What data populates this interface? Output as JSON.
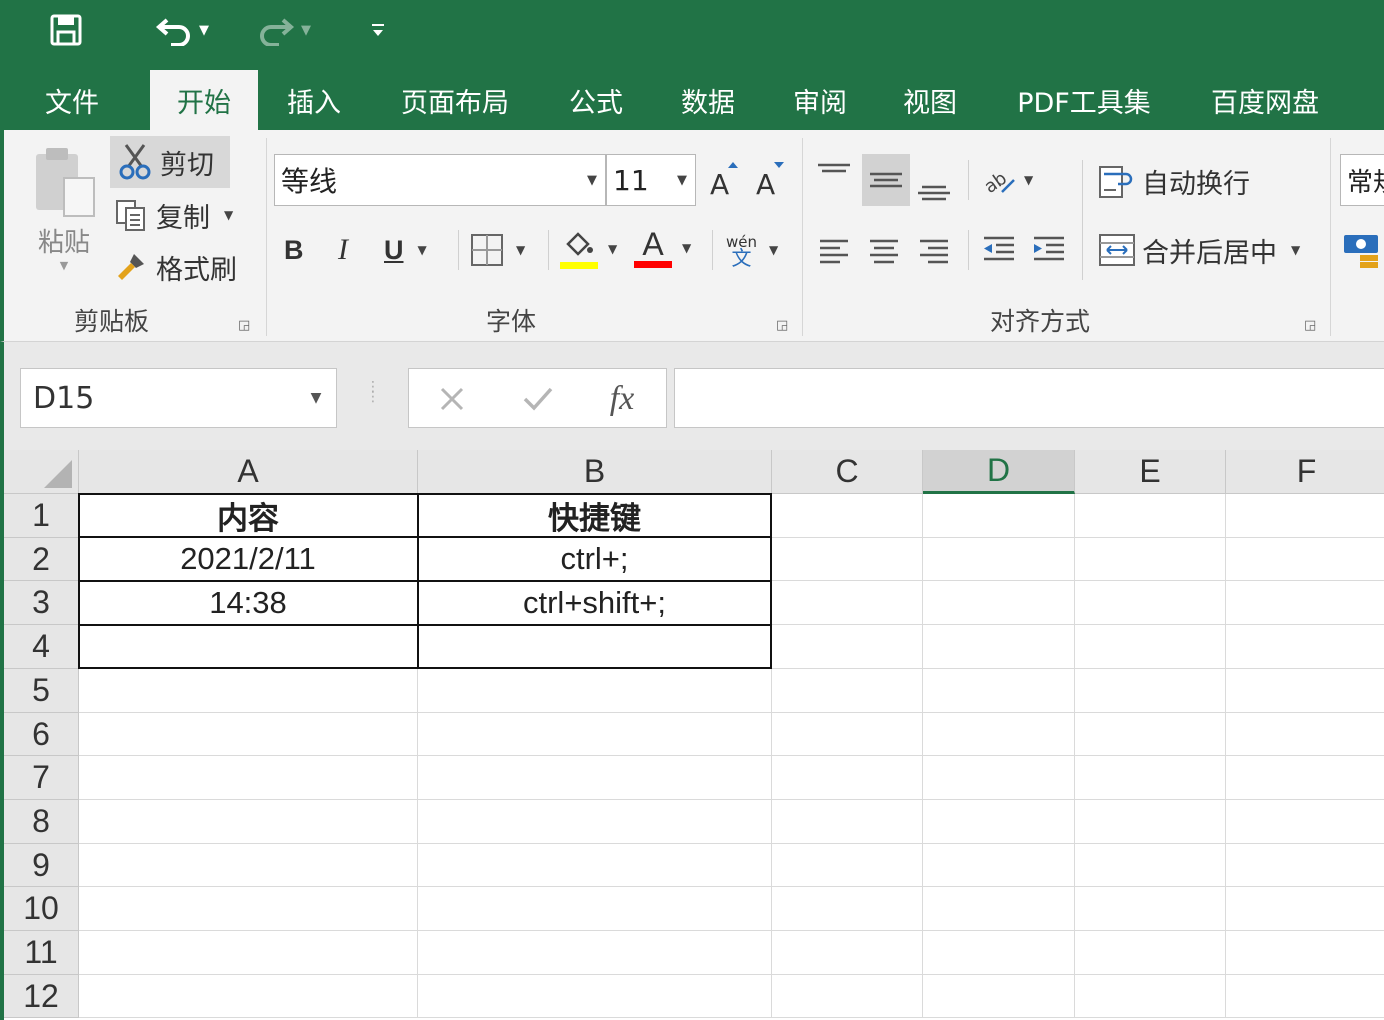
{
  "tabs": [
    "文件",
    "开始",
    "插入",
    "页面布局",
    "公式",
    "数据",
    "审阅",
    "视图",
    "PDF工具集",
    "百度网盘"
  ],
  "active_tab": "开始",
  "clipboard": {
    "paste": "粘贴",
    "cut": "剪切",
    "copy": "复制",
    "format_painter": "格式刷",
    "group_label": "剪贴板"
  },
  "font": {
    "name": "等线",
    "size": "11",
    "group_label": "字体",
    "bold": "B",
    "italic": "I",
    "underline": "U",
    "font_color_letter": "A",
    "phonetic_top": "wén",
    "phonetic_bottom": "文",
    "fill_color": "#ffff00",
    "font_color": "#ff0000"
  },
  "alignment": {
    "wrap_text": "自动换行",
    "merge_center": "合并后居中",
    "group_label": "对齐方式"
  },
  "number": {
    "format_partial": "常规"
  },
  "formula_bar": {
    "name_box": "D15",
    "fx": "fx",
    "formula": ""
  },
  "sheet": {
    "columns": [
      "A",
      "B",
      "C",
      "D",
      "E",
      "F"
    ],
    "selected_column": "D",
    "rows": [
      "1",
      "2",
      "3",
      "4",
      "5",
      "6",
      "7",
      "8",
      "9",
      "10",
      "11",
      "12"
    ],
    "cells": {
      "A1": "内容",
      "B1": "快捷键",
      "A2": "2021/2/11",
      "B2": "ctrl+;",
      "A3": "14:38",
      "B3": "ctrl+shift+;"
    }
  },
  "colors": {
    "excel_green": "#217346",
    "ribbon_bg": "#f3f3f3"
  }
}
